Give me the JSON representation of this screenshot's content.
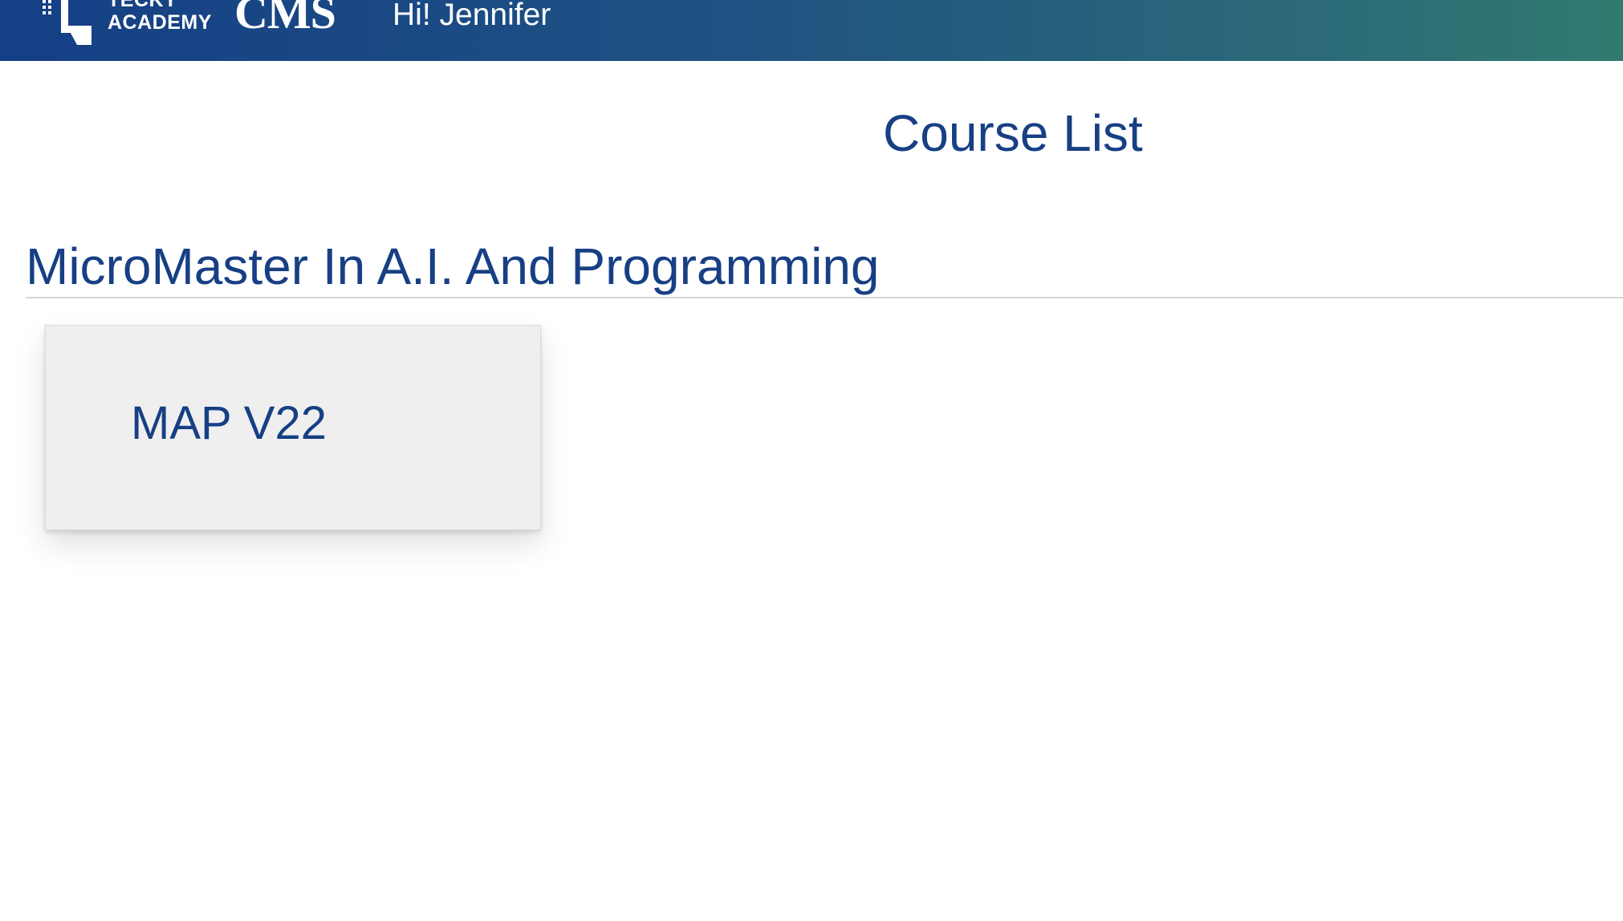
{
  "header": {
    "logo_line1": "TECKY",
    "logo_line2": "ACADEMY",
    "logo_product": "CMS",
    "greeting": "Hi! Jennifer",
    "gradient_colors": [
      "#153f86",
      "#317a70"
    ]
  },
  "main": {
    "page_title": "Course List",
    "section_title": "MicroMaster In A.I. And Programming",
    "accent_color": "#173f84",
    "courses": [
      {
        "name": "MAP V22"
      }
    ]
  }
}
